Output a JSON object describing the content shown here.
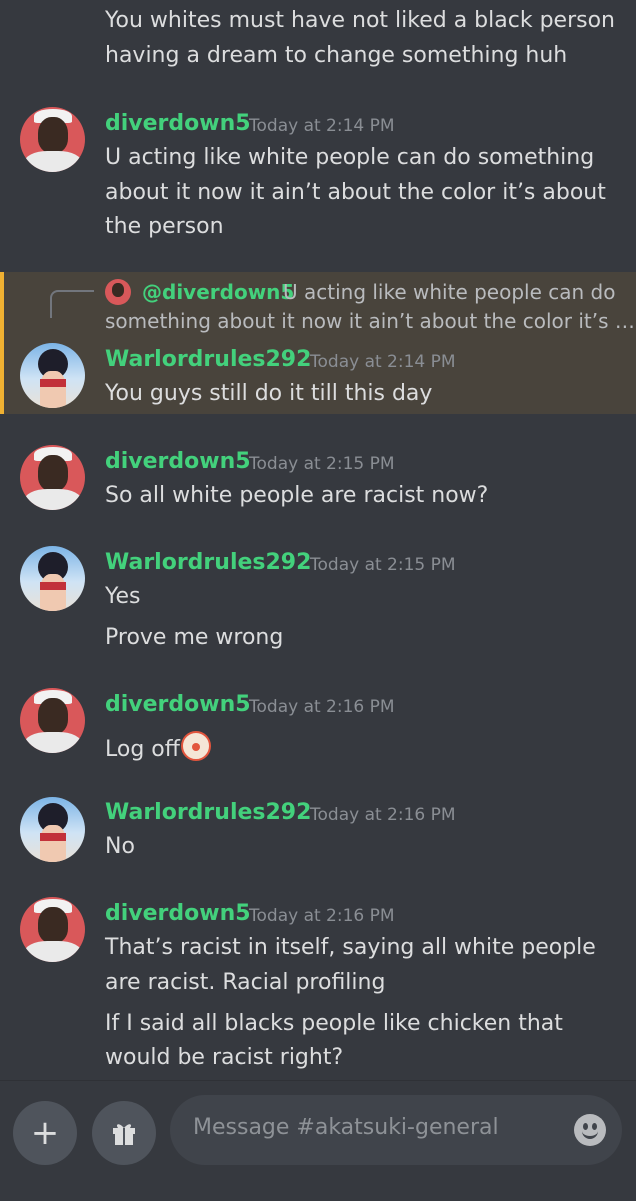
{
  "channel": {
    "input_placeholder": "Message #akatsuki-general"
  },
  "top_continuation": {
    "lines": [
      "You whites must have not liked a black person",
      "having a dream to change something huh"
    ]
  },
  "reply": {
    "name": "@diverdown5",
    "text_line1": "U acting like white people can do",
    "text_line2": "something about it now it ain’t about the color it’s …"
  },
  "messages": [
    {
      "author": "diverdown5",
      "time": "Today at 2:14 PM",
      "lines": [
        "U acting like white people can do something",
        "about it now it ain’t about the color it’s about",
        "the person"
      ]
    },
    {
      "author": "Warlordrules292",
      "time": "Today at 2:14 PM",
      "lines": [
        "You guys still do it till this day"
      ]
    },
    {
      "author": "diverdown5",
      "time": "Today at 2:15 PM",
      "lines": [
        "So all white people are racist now?"
      ]
    },
    {
      "author": "Warlordrules292",
      "time": "Today at 2:15 PM",
      "lines": [
        "Yes",
        "Prove me wrong"
      ]
    },
    {
      "author": "diverdown5",
      "time": "Today at 2:16 PM",
      "lines": [
        "Log off"
      ]
    },
    {
      "author": "Warlordrules292",
      "time": "Today at 2:16 PM",
      "lines": [
        "No"
      ]
    },
    {
      "author": "diverdown5",
      "time": "Today at 2:16 PM",
      "lines": [
        "That’s racist in itself, saying all white people",
        "are racist. Racial profiling",
        "If I said all blacks people like chicken that",
        "would be racist right?"
      ]
    }
  ],
  "icons": {
    "add": "plus-icon",
    "gift": "gift-icon",
    "emoji": "emoji-icon",
    "clown": "clown-emoji"
  },
  "colors": {
    "background": "#36393f",
    "username": "#43d17c",
    "highlight": "#49443c",
    "highlight_bar": "#f0b132"
  }
}
